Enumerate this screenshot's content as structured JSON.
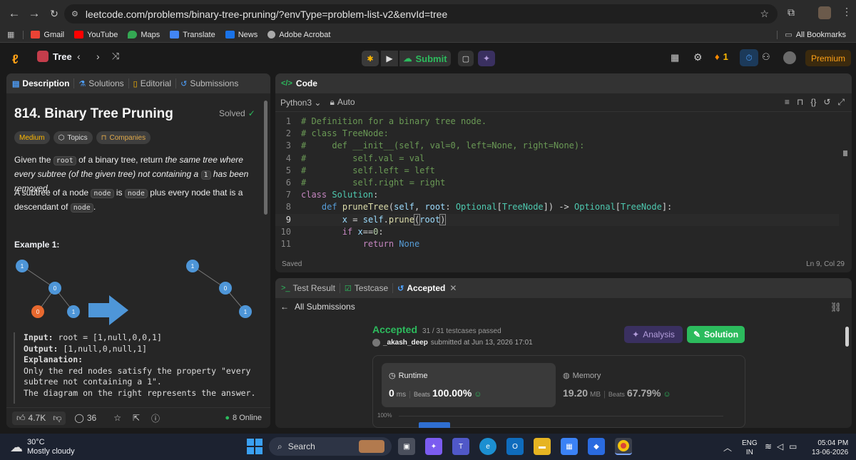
{
  "browser": {
    "url": "leetcode.com/problems/binary-tree-pruning/?envType=problem-list-v2&envId=tree",
    "bookmarks": [
      "Gmail",
      "YouTube",
      "Maps",
      "Translate",
      "News",
      "Adobe Acrobat"
    ],
    "all_bookmarks": "All Bookmarks"
  },
  "nav": {
    "problem_list": "Tree",
    "submit": "Submit",
    "streak": "1",
    "premium": "Premium"
  },
  "left": {
    "tabs": [
      "Description",
      "Solutions",
      "Editorial",
      "Submissions"
    ],
    "title": "814. Binary Tree Pruning",
    "solved": "Solved",
    "tags": [
      "Medium",
      "Topics",
      "Companies"
    ],
    "desc1_a": "Given the ",
    "desc1_code": "root",
    "desc1_b": " of a binary tree, return ",
    "desc1_em": "the same tree where every subtree (of the given tree) not containing a ",
    "desc1_code2": "1",
    "desc1_em2": " has been removed",
    "desc1_end": ".",
    "desc2_a": "A subtree of a node ",
    "desc2_code": "node",
    "desc2_b": " is ",
    "desc2_code2": "node",
    "desc2_c": " plus every node that is a descendant of ",
    "desc2_code3": "node",
    "desc2_end": ".",
    "example_title": "Example 1:",
    "tree_left": [
      "1",
      "0",
      "0",
      "1"
    ],
    "tree_right": [
      "1",
      "0",
      "1"
    ],
    "input_label": "Input:",
    "input_val": " root = [1,null,0,0,1]",
    "output_label": "Output:",
    "output_val": " [1,null,0,null,1]",
    "explanation_label": "Explanation:",
    "explanation_lines": [
      "Only the red nodes satisfy the property \"every",
      "subtree not containing a 1\".",
      "The diagram on the right represents the answer."
    ],
    "likes": "4.7K",
    "comments": "36",
    "online": "8 Online"
  },
  "code": {
    "header": "Code",
    "language": "Python3",
    "mode": "Auto",
    "status": "Saved",
    "position": "Ln 9, Col 29"
  },
  "result": {
    "tabs": [
      "Test Result",
      "Testcase",
      "Accepted"
    ],
    "back": "All Submissions",
    "status": "Accepted",
    "passed": "31 / 31 testcases passed",
    "user": "_akash_deep",
    "submitted": "submitted at Jun 13, 2026 17:01",
    "analysis": "Analysis",
    "solution": "Solution",
    "runtime_label": "Runtime",
    "runtime_val": "0",
    "runtime_unit": "ms",
    "beats_label": "Beats",
    "runtime_beats": "100.00%",
    "memory_label": "Memory",
    "memory_val": "19.20",
    "memory_unit": "MB",
    "memory_beats": "67.79%",
    "chart_tick": "100%"
  },
  "taskbar": {
    "temp": "30°C",
    "weather": "Mostly cloudy",
    "search": "Search",
    "lang1": "ENG",
    "lang2": "IN",
    "time": "05:04 PM",
    "date": "13-06-2026"
  },
  "colors": {
    "accepted": "#2cbb5d",
    "medium": "#ffb800",
    "premium_bg": "#3b2a0e",
    "node_blue": "#4e96d8",
    "node_red": "#e8692f"
  }
}
